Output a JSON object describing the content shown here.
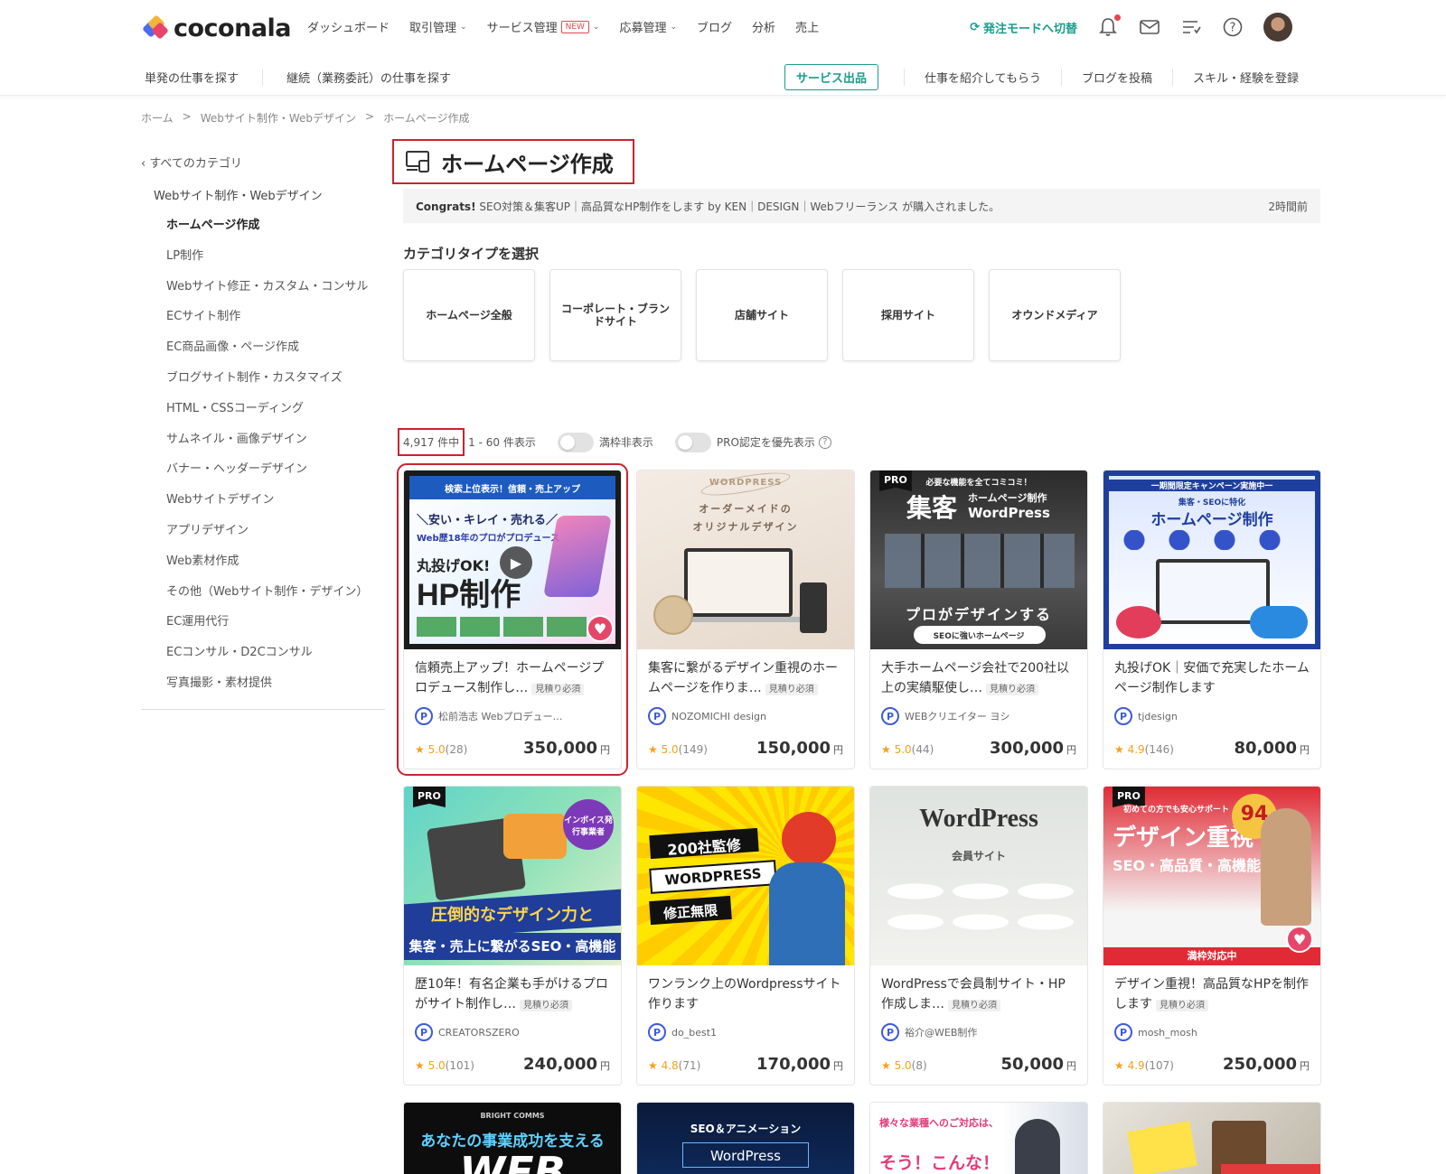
{
  "header": {
    "logo_text": "coconala",
    "nav": [
      {
        "label": "ダッシュボード",
        "chevron": false,
        "badge": ""
      },
      {
        "label": "取引管理",
        "chevron": true,
        "badge": ""
      },
      {
        "label": "サービス管理",
        "chevron": true,
        "badge": "NEW"
      },
      {
        "label": "応募管理",
        "chevron": true,
        "badge": ""
      },
      {
        "label": "ブログ",
        "chevron": false,
        "badge": ""
      },
      {
        "label": "分析",
        "chevron": false,
        "badge": ""
      },
      {
        "label": "売上",
        "chevron": false,
        "badge": ""
      }
    ],
    "switch_mode": "発注モードへ切替",
    "icons": [
      "bell-icon",
      "mail-icon",
      "list-icon",
      "help-icon"
    ]
  },
  "subbar": {
    "left": [
      "単発の仕事を探す",
      "継続（業務委託）の仕事を探す"
    ],
    "publish": "サービス出品",
    "right": [
      "仕事を紹介してもらう",
      "ブログを投稿",
      "スキル・経験を登録"
    ]
  },
  "breadcrumb": [
    "ホーム",
    "Webサイト制作・Webデザイン",
    "ホームページ作成"
  ],
  "sidebar": {
    "back": "すべてのカテゴリ",
    "parent": "Webサイト制作・Webデザイン",
    "items": [
      "ホームページ作成",
      "LP制作",
      "Webサイト修正・カスタム・コンサル",
      "ECサイト制作",
      "EC商品画像・ページ作成",
      "ブログサイト制作・カスタマイズ",
      "HTML・CSSコーディング",
      "サムネイル・画像デザイン",
      "バナー・ヘッダーデザイン",
      "Webサイトデザイン",
      "アプリデザイン",
      "Web素材作成",
      "その他（Webサイト制作・デザイン）",
      "EC運用代行",
      "ECコンサル・D2Cコンサル",
      "写真撮影・素材提供"
    ]
  },
  "main": {
    "title": "ホームページ作成",
    "congrats_bold": "Congrats!",
    "congrats_text": " SEO対策＆集客UP｜高品質なHP制作をします by KEN｜DESIGN｜Webフリーランス が購入されました。",
    "congrats_time": "2時間前",
    "type_label": "カテゴリタイプを選択",
    "types": [
      "ホームページ全般",
      "コーポレート・ブランドサイト",
      "店舗サイト",
      "採用サイト",
      "オウンドメディア"
    ],
    "count": "4,917 件中",
    "range": "1 - 60 件表示",
    "toggle1": "満枠非表示",
    "toggle2": "PRO認定を優先表示"
  },
  "cards": [
    {
      "title": "信頼売上アップ！ホームページプロデュース制作し…",
      "quote": "見積り必須",
      "seller": "松前浩志 Webプロデュー…",
      "rating": "5.0",
      "count": "(28)",
      "price": "350,000",
      "yen": "円"
    },
    {
      "title": "集客に繋がるデザイン重視のホームページを作りま…",
      "quote": "見積り必須",
      "seller": "NOZOMICHI design",
      "rating": "5.0",
      "count": "(149)",
      "price": "150,000",
      "yen": "円"
    },
    {
      "title": "大手ホームページ会社で200社以上の実績駆使し…",
      "quote": "見積り必須",
      "seller": "WEBクリエイター ヨシ",
      "rating": "5.0",
      "count": "(44)",
      "price": "300,000",
      "yen": "円"
    },
    {
      "title": "丸投げOK｜安価で充実したホームページ制作します",
      "quote": "",
      "seller": "tjdesign",
      "rating": "4.9",
      "count": "(146)",
      "price": "80,000",
      "yen": "円"
    },
    {
      "title": "歴10年！有名企業も手がけるプロがサイト制作し…",
      "quote": "見積り必須",
      "seller": "CREATORSZERO",
      "rating": "5.0",
      "count": "(101)",
      "price": "240,000",
      "yen": "円"
    },
    {
      "title": "ワンランク上のWordpressサイト作ります",
      "quote": "",
      "seller": "do_best1",
      "rating": "4.8",
      "count": "(71)",
      "price": "170,000",
      "yen": "円"
    },
    {
      "title": "WordPressで会員制サイト・HP作成しま…",
      "quote": "見積り必須",
      "seller": "裕介@WEB制作",
      "rating": "5.0",
      "count": "(8)",
      "price": "50,000",
      "yen": "円"
    },
    {
      "title": "デザイン重視！高品質なHPを制作します",
      "quote": "見積り必須",
      "seller": "mosh_mosh",
      "rating": "4.9",
      "count": "(107)",
      "price": "250,000",
      "yen": "円"
    }
  ],
  "thumbs": {
    "t1a": "検索上位表示！信頼・売上アップ",
    "t1b": "＼安い・キレイ・売れる／",
    "t1c": "Web歴18年のプロがプロデュース",
    "t1d": "丸投げOK!",
    "t1e": "HP制作",
    "t2a": "WORDPRESS",
    "t2b": "オーダーメイドの",
    "t2c": "オリジナルデザイン",
    "t3a": "必要な機能を全てコミコミ！",
    "t3b": "集客",
    "t3c": "ホームページ制作",
    "t3d": "WordPress",
    "t3e": "プロがデザインする",
    "t3f": "SEOに強いホームページ",
    "t4a": "一期間限定キャンペーン実施中一",
    "t4b": "集客・SEOに特化",
    "t4c": "ホームページ制作",
    "t5a": "インボイス発行事業者",
    "t5b": "圧倒的なデザイン力と",
    "t5c": "集客・売上に繋がるSEO・高機能",
    "t6a": "200社監修",
    "t6b": "WORDPRESS",
    "t6c": "修正無限",
    "t7a": "WordPress",
    "t7b": "会員サイト",
    "t8a": "初めての方でも安心サポート",
    "t8b": "デザイン重視",
    "t8c": "SEO・高品質・高機能",
    "t8d": "94",
    "t8e": "満枠対応中",
    "t9a": "BRIGHT COMMS",
    "t9b": "あなたの事業成功を支える",
    "t9c": "WEB",
    "t10a": "SEO＆アニメーション",
    "t10b": "WordPress",
    "t11a": "様々な業種へのご対応は、",
    "t11b": "そう！こんな！"
  },
  "colors": {
    "accent": "#1a9c8a",
    "highlight": "#c8242f",
    "star": "#f4a11b",
    "pro_badge": "#3d5bd9"
  }
}
